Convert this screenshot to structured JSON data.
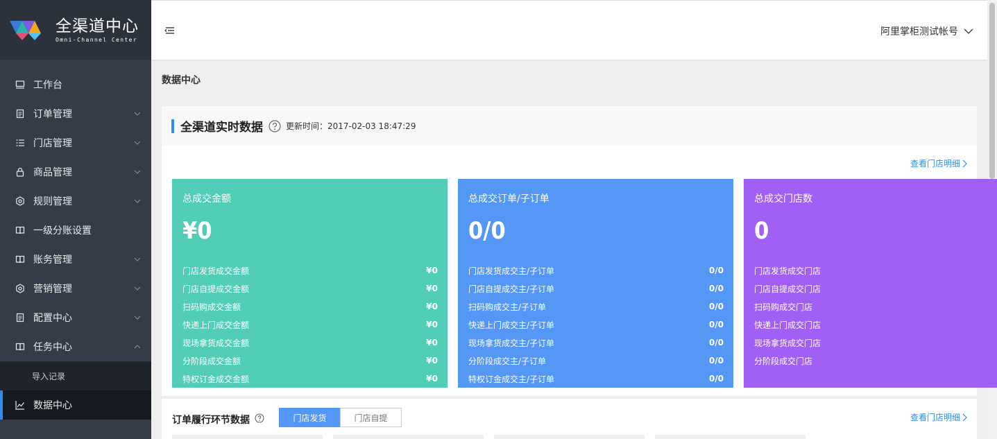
{
  "app": {
    "logo_title": "全渠道中心",
    "logo_sub": "Omni-Channel Center"
  },
  "sidebar": {
    "items": [
      {
        "label": "工作台",
        "icon": "monitor-icon",
        "arrow": ""
      },
      {
        "label": "订单管理",
        "icon": "document-icon",
        "arrow": "down"
      },
      {
        "label": "门店管理",
        "icon": "list-icon",
        "arrow": "down"
      },
      {
        "label": "商品管理",
        "icon": "lock-icon",
        "arrow": "down"
      },
      {
        "label": "规则管理",
        "icon": "gear-icon",
        "arrow": "down"
      },
      {
        "label": "一级分账设置",
        "icon": "book-icon",
        "arrow": ""
      },
      {
        "label": "账务管理",
        "icon": "book-icon",
        "arrow": "down"
      },
      {
        "label": "营销管理",
        "icon": "gear-icon",
        "arrow": "down"
      },
      {
        "label": "配置中心",
        "icon": "document-icon",
        "arrow": "down"
      },
      {
        "label": "任务中心",
        "icon": "book-icon",
        "arrow": "up"
      }
    ],
    "sub_item": "导入记录",
    "active_item": "数据中心"
  },
  "header": {
    "account": "阿里掌柜测试帐号"
  },
  "page": {
    "title": "数据中心"
  },
  "realtime": {
    "title": "全渠道实时数据",
    "updated": "更新时间：2017-02-03 18:47:29",
    "detail_link": "查看门店明细"
  },
  "cards": [
    {
      "title": "总成交金额",
      "big": "¥0",
      "color": "#52cdb8",
      "rows": [
        {
          "label": "门店发货成交金额",
          "value": "¥0"
        },
        {
          "label": "门店自提成交金额",
          "value": "¥0"
        },
        {
          "label": "扫码购成交金额",
          "value": "¥0"
        },
        {
          "label": "快递上门成交金额",
          "value": "¥0"
        },
        {
          "label": "现场拿货成交金额",
          "value": "¥0"
        },
        {
          "label": "分阶段成交金额",
          "value": "¥0"
        },
        {
          "label": "特权订金成交金额",
          "value": "¥0"
        }
      ]
    },
    {
      "title": "总成交订单/子订单",
      "big": "0/0",
      "color": "#5597f5",
      "rows": [
        {
          "label": "门店发货成交主/子订单",
          "value": "0/0"
        },
        {
          "label": "门店自提成交主/子订单",
          "value": "0/0"
        },
        {
          "label": "扫码购成交主/子订单",
          "value": "0/0"
        },
        {
          "label": "快递上门成交主/子订单",
          "value": "0/0"
        },
        {
          "label": "现场拿货成交主/子订单",
          "value": "0/0"
        },
        {
          "label": "分阶段成交主/子订单",
          "value": "0/0"
        },
        {
          "label": "特权订金成交主/子订单",
          "value": "0/0"
        }
      ]
    },
    {
      "title": "总成交门店数",
      "big": "0",
      "color": "#a160f3",
      "rows": [
        {
          "label": "门店发货成交门店",
          "value": "0"
        },
        {
          "label": "门店自提成交门店",
          "value": "0"
        },
        {
          "label": "扫码购成交门店",
          "value": "0"
        },
        {
          "label": "快递上门成交门店",
          "value": "0"
        },
        {
          "label": "现场拿货成交门店",
          "value": "0"
        },
        {
          "label": "分阶段成交门店",
          "value": "0"
        }
      ]
    }
  ],
  "fulfillment": {
    "title": "订单履行环节数据",
    "tabs": [
      "门店发货",
      "门店自提"
    ],
    "active_tab": 0,
    "detail_link": "查看门店明细"
  },
  "colors": {
    "accent": "#2d8cf0",
    "sidebar_bg": "#333c47"
  }
}
